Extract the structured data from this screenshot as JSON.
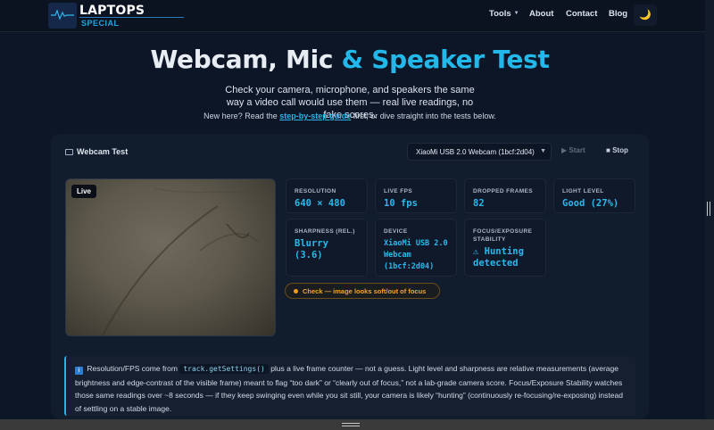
{
  "header": {
    "brand_top": "LAPTOPS",
    "brand_sub": "SPECIAL",
    "nav": [
      {
        "label": "Tools",
        "has_caret": true
      },
      {
        "label": "About"
      },
      {
        "label": "Contact"
      },
      {
        "label": "Blog"
      }
    ],
    "theme_icon": "moon-icon"
  },
  "hero": {
    "title_main": "Webcam, Mic ",
    "title_accent": "& Speaker Test",
    "subtitle": "Check your camera, microphone, and speakers the same way a video call would use them — real live readings, no fake scores.",
    "note_prefix": "New here? Read the ",
    "note_link": "step-by-step guide",
    "note_suffix": " first, or dive straight into the tests below."
  },
  "webcam": {
    "title": "Webcam Test",
    "device": "XiaoMi USB 2.0 Webcam (1bcf:2d04)",
    "start_label": "Start",
    "stop_label": "Stop",
    "live_label": "Live",
    "stats": [
      {
        "label": "RESOLUTION",
        "value": "640 × 480"
      },
      {
        "label": "LIVE FPS",
        "value": "10 fps"
      },
      {
        "label": "DROPPED FRAMES",
        "value": "82"
      },
      {
        "label": "LIGHT LEVEL",
        "value": "Good (27%)"
      },
      {
        "label": "SHARPNESS (REL.)",
        "value": "Blurry (3.6)"
      },
      {
        "label": "DEVICE",
        "value": "XiaoMi USB 2.0 Webcam (1bcf:2d04)"
      },
      {
        "label": "FOCUS/EXPOSURE STABILITY",
        "value": "⚠ Hunting detected"
      }
    ],
    "check": "Check — image looks soft/out of focus",
    "info": {
      "icon": "i",
      "prefix": "Resolution/FPS come from ",
      "code": "track.getSettings()",
      "suffix": " plus a live frame counter — not a guess. Light level and sharpness are relative measurements (average brightness and edge-contrast of the visible frame) meant to flag “too dark” or “clearly out of focus,” not a lab-grade camera score. Focus/Exposure Stability watches those same readings over ~8 seconds — if they keep swinging even while you sit still, your camera is likely “hunting” (continuously re-focusing/re-exposing) instead of settling on a stable image."
    }
  },
  "colors": {
    "background": "#0d1626",
    "accent": "#23b8ea",
    "warning": "#f0a531"
  }
}
